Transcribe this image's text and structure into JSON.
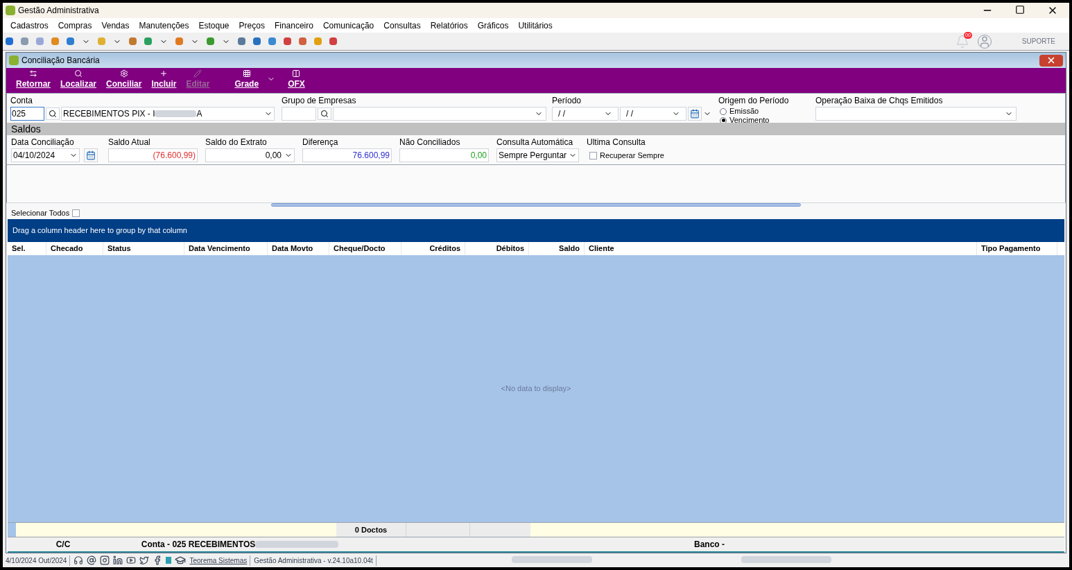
{
  "window": {
    "title": "Gestão Administrativa"
  },
  "menu": [
    "Cadastros",
    "Compras",
    "Vendas",
    "Manutenções",
    "Estoque",
    "Preços",
    "Financeiro",
    "Comunicação",
    "Consultas",
    "Relatórios",
    "Gráficos",
    "Utilitários"
  ],
  "top_toolbar": {
    "notification_badge": "00",
    "support": "SUPORTE"
  },
  "child_window": {
    "title": "Conciliação Bancária"
  },
  "actions": [
    {
      "label": "Retornar",
      "disabled": false
    },
    {
      "label": "Localizar",
      "disabled": false
    },
    {
      "label": "Conciliar",
      "disabled": false
    },
    {
      "label": "Incluir",
      "disabled": false
    },
    {
      "label": "Editar",
      "disabled": true
    },
    {
      "label": "Grade",
      "disabled": false
    },
    {
      "label": "OFX",
      "disabled": false
    }
  ],
  "filters": {
    "conta_label": "Conta",
    "conta_code": "025",
    "conta_name_start": "RECEBIMENTOS PIX - I",
    "conta_name_end": "A",
    "grupo_label": "Grupo de Empresas",
    "periodo_label": "Período",
    "periodo_from": "/ /",
    "periodo_to": "/ /",
    "origem_label": "Origem do Período",
    "origem_options": [
      {
        "label": "Emissão",
        "selected": false
      },
      {
        "label": "Vencimento",
        "selected": true
      }
    ],
    "operacao_label": "Operação Baixa de Chqs Emitidos"
  },
  "saldos": {
    "title": "Saldos",
    "fields": [
      {
        "label": "Data Conciliação",
        "value": "04/10/2024",
        "kind": "date"
      },
      {
        "label": "Saldo Atual",
        "value": "(76.600,99)",
        "kind": "amount",
        "color": "#e03030"
      },
      {
        "label": "Saldo do Extrato",
        "value": "0,00",
        "kind": "dropdown_amount"
      },
      {
        "label": "Diferença",
        "value": "76.600,99",
        "kind": "amount",
        "color": "#3030d0"
      },
      {
        "label": "Não Conciliados",
        "value": "0,00",
        "kind": "amount",
        "color": "#20a020"
      },
      {
        "label": "Consulta Automática",
        "value": "Sempre Perguntar",
        "kind": "select"
      }
    ],
    "ultima_label": "Ultima Consulta",
    "recuperar": {
      "label": "Recuperar Sempre",
      "checked": false
    }
  },
  "select_all": {
    "label": "Selecionar Todos",
    "checked": false
  },
  "grid": {
    "group_hint": "Drag a column header here to group by that column",
    "columns": [
      "Sel.",
      "Checado",
      "Status",
      "Data Vencimento",
      "Data Movto",
      "Cheque/Docto",
      "Créditos",
      "Débitos",
      "Saldo",
      "Cliente",
      "Tipo Pagamento"
    ],
    "empty": "<No data to display>",
    "summary": "0 Doctos"
  },
  "footer": {
    "cc": "C/C",
    "conta": "Conta - 025 RECEBIMENTOS",
    "banco": "Banco -"
  },
  "status_bar": {
    "date": "4/10/2024 Out/2024",
    "company_link": "Teorema Sistemas",
    "version": "Gestão Administrativa - v.24.10a10.04t"
  }
}
